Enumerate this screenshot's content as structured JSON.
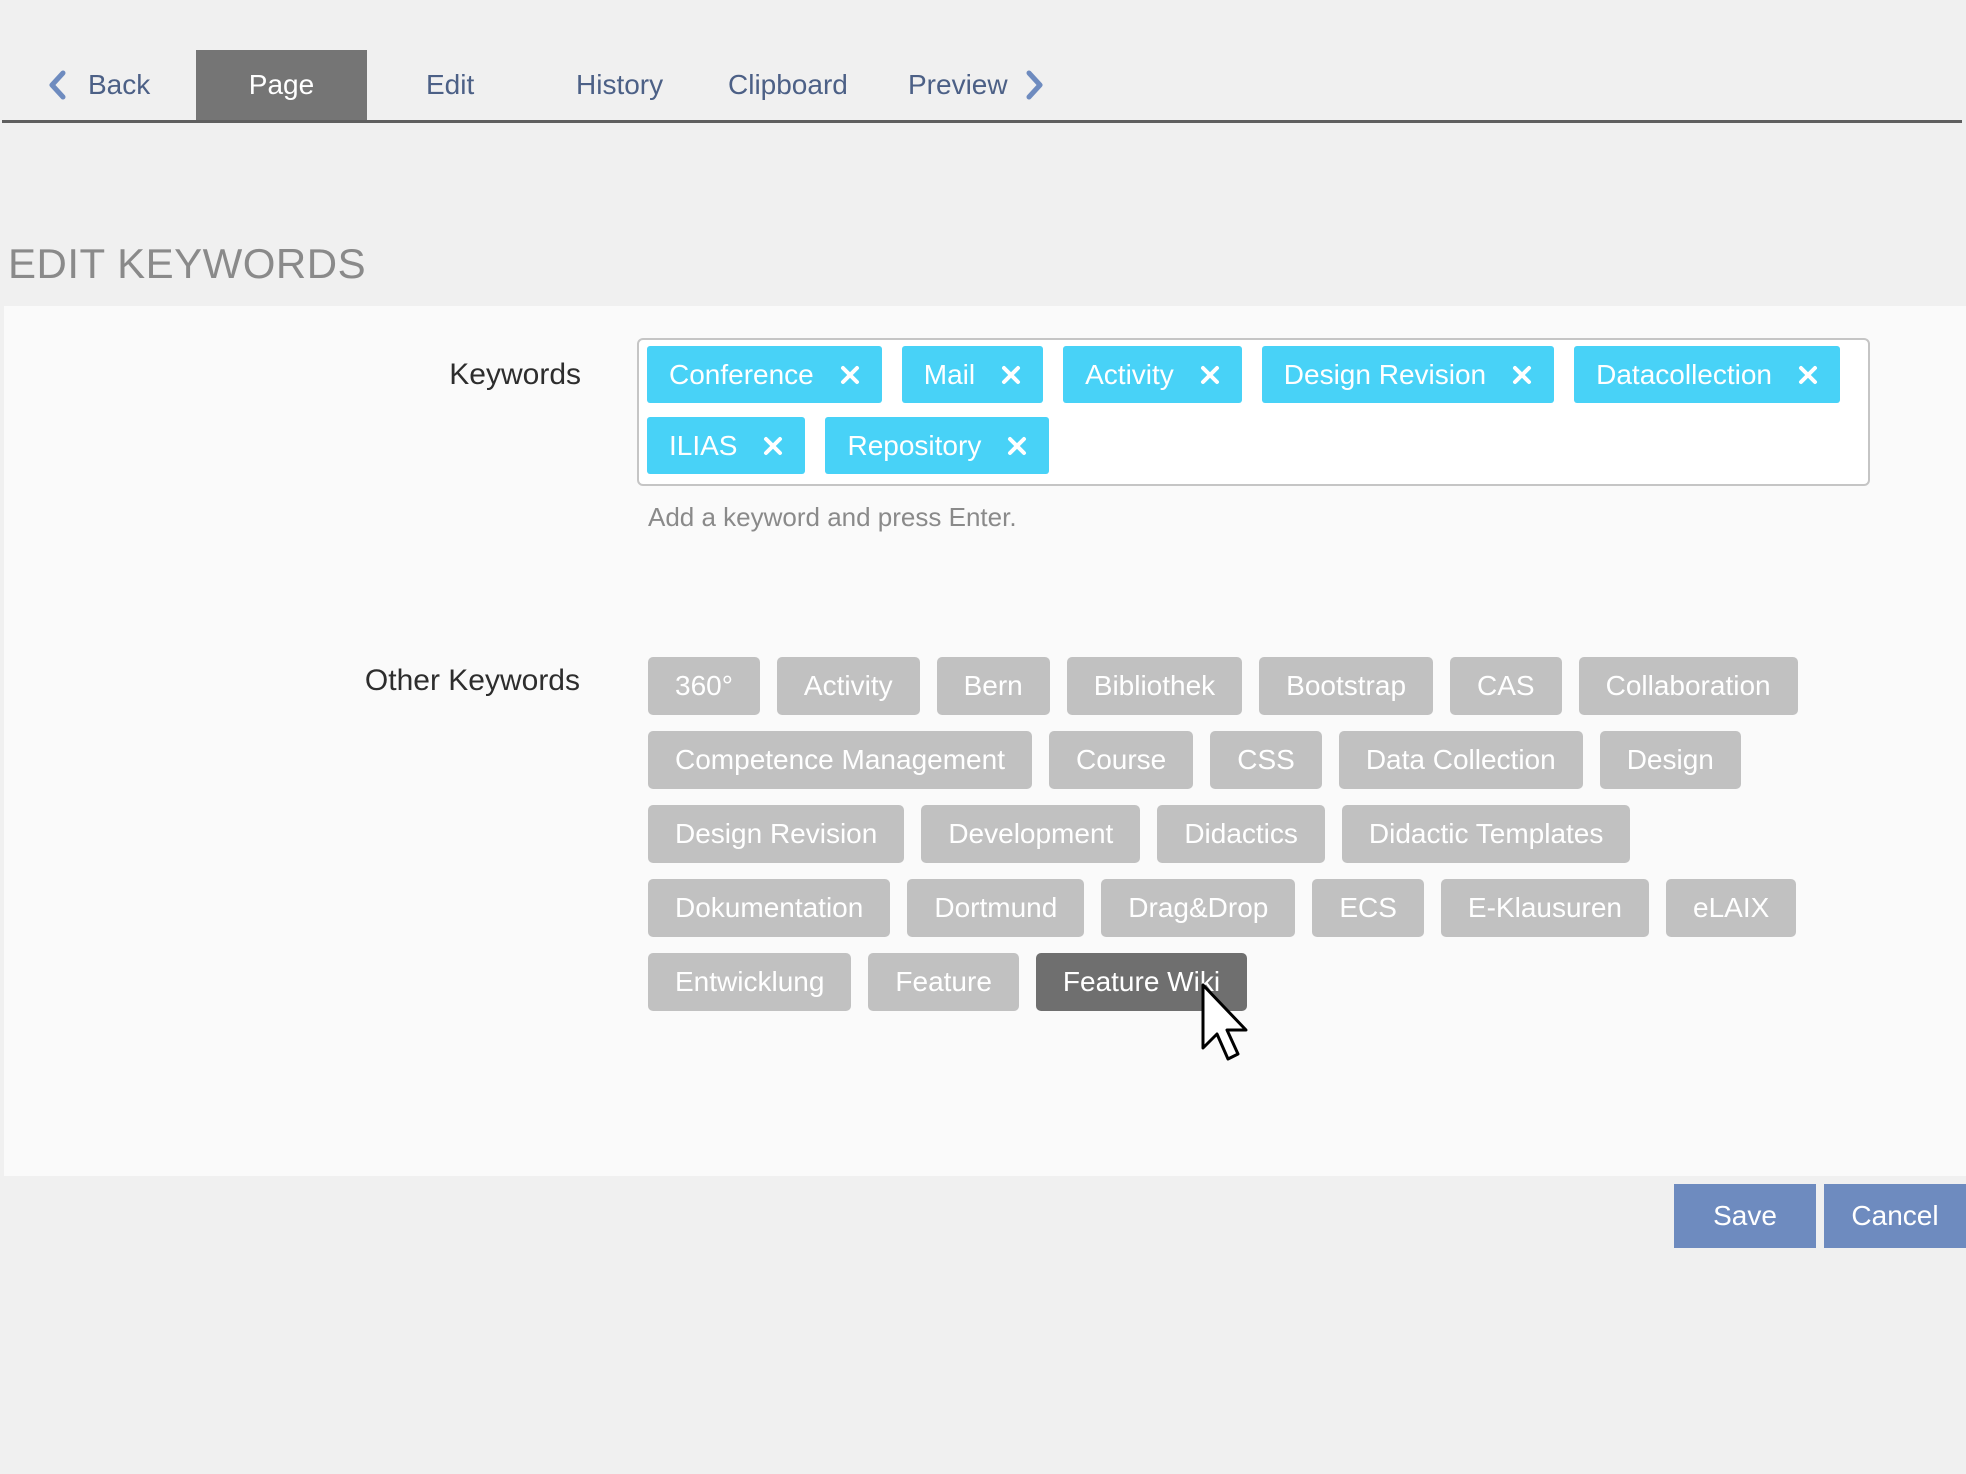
{
  "tabs": {
    "back": "Back",
    "page": "Page",
    "edit": "Edit",
    "history": "History",
    "clipboard": "Clipboard",
    "preview": "Preview",
    "active": "Page"
  },
  "heading": "EDIT KEYWORDS",
  "form": {
    "keywords_label": "Keywords",
    "keywords": [
      {
        "label": "Conference"
      },
      {
        "label": "Mail"
      },
      {
        "label": "Activity"
      },
      {
        "label": "Design Revision"
      },
      {
        "label": "Datacollection"
      },
      {
        "label": "ILIAS"
      },
      {
        "label": "Repository"
      }
    ],
    "keyword_hint": "Add a keyword and press Enter.",
    "other_label": "Other Keywords",
    "other_keywords": [
      {
        "label": "360°"
      },
      {
        "label": "Activity"
      },
      {
        "label": "Bern"
      },
      {
        "label": "Bibliothek"
      },
      {
        "label": "Bootstrap"
      },
      {
        "label": "CAS"
      },
      {
        "label": "Collaboration"
      },
      {
        "label": "Competence Management"
      },
      {
        "label": "Course"
      },
      {
        "label": "CSS"
      },
      {
        "label": "Data Collection"
      },
      {
        "label": "Design"
      },
      {
        "label": "Design Revision"
      },
      {
        "label": "Development"
      },
      {
        "label": "Didactics"
      },
      {
        "label": "Didactic Templates"
      },
      {
        "label": "Dokumentation"
      },
      {
        "label": "Dortmund"
      },
      {
        "label": "Drag&Drop"
      },
      {
        "label": "ECS"
      },
      {
        "label": "E-Klausuren"
      },
      {
        "label": "eLAIX"
      },
      {
        "label": "Entwicklung"
      },
      {
        "label": "Feature"
      },
      {
        "label": "Feature Wiki"
      }
    ],
    "hovered_keyword": "Feature Wiki"
  },
  "buttons": {
    "save": "Save",
    "cancel": "Cancel"
  },
  "colors": {
    "accent_tag": "#48d2f7",
    "other_tag": "#c1c1c1",
    "hovered_tag": "#6f6f6f",
    "button": "#6e8bbf",
    "active_tab": "#757575",
    "link": "#4c6086"
  },
  "icons": {
    "back": "chevron-left-icon",
    "preview": "chevron-right-icon",
    "remove": "close-icon",
    "cursor": "mouse-pointer-icon"
  }
}
